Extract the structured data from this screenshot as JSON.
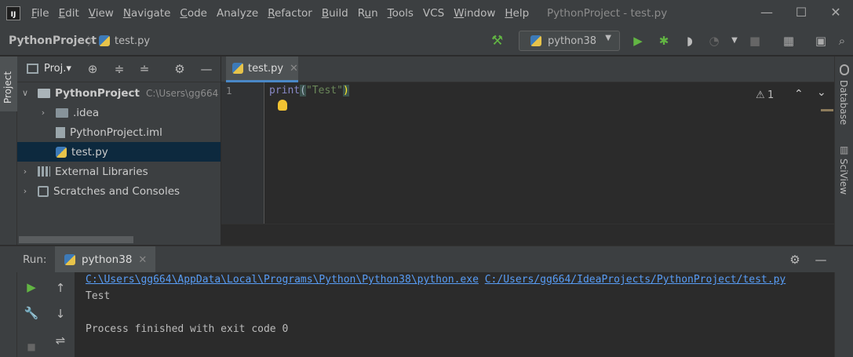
{
  "app": {
    "logo_text": "IJ",
    "menu": [
      "File",
      "Edit",
      "View",
      "Navigate",
      "Code",
      "Analyze",
      "Refactor",
      "Build",
      "Run",
      "Tools",
      "VCS",
      "Window",
      "Help"
    ],
    "menu_mnemonic": [
      "F",
      "E",
      "V",
      "N",
      "C",
      "",
      "R",
      "B",
      "u",
      "T",
      "",
      "W",
      "H"
    ],
    "window_title": "PythonProject - test.py"
  },
  "breadcrumb": {
    "project": "PythonProject",
    "file": "test.py"
  },
  "toolbar": {
    "run_config": "python38"
  },
  "sidebar": {
    "project_tool_label": "Project",
    "panel_title": "Proj.▾",
    "tree": [
      {
        "label": "PythonProject",
        "path": "C:\\Users\\gg664",
        "indent": 0,
        "arrow": "∨",
        "icon": "folder-open"
      },
      {
        "label": ".idea",
        "indent": 1,
        "arrow": "›",
        "icon": "folder"
      },
      {
        "label": "PythonProject.iml",
        "indent": 1,
        "arrow": "",
        "icon": "file"
      },
      {
        "label": "test.py",
        "indent": 1,
        "arrow": "",
        "icon": "python",
        "selected": true
      },
      {
        "label": "External Libraries",
        "indent": 0,
        "arrow": "›",
        "icon": "library"
      },
      {
        "label": "Scratches and Consoles",
        "indent": 0,
        "arrow": "›",
        "icon": "scratch"
      }
    ]
  },
  "editor": {
    "tab_label": "test.py",
    "line_number": "1",
    "code": {
      "fn": "print",
      "open": "(",
      "str": "\"Test\"",
      "close": ")"
    },
    "warning_count": "1"
  },
  "right_strip": {
    "database_label": "Database",
    "sciview_label": "SciView"
  },
  "run_panel": {
    "label": "Run:",
    "tab_label": "python38",
    "console": {
      "exe_path": "C:\\Users\\gg664\\AppData\\Local\\Programs\\Python\\Python38\\python.exe",
      "script_path": "C:/Users/gg664/IdeaProjects/PythonProject/test.py",
      "output": "Test",
      "exit_message": "Process finished with exit code 0"
    }
  },
  "colors": {
    "background": "#2b2b2b",
    "panel": "#3c3f41",
    "selection": "#0d293e",
    "accent_blue": "#4a88c7",
    "run_green": "#62b543",
    "link": "#589df6",
    "keyword": "#8888c6",
    "string": "#6a8759"
  }
}
